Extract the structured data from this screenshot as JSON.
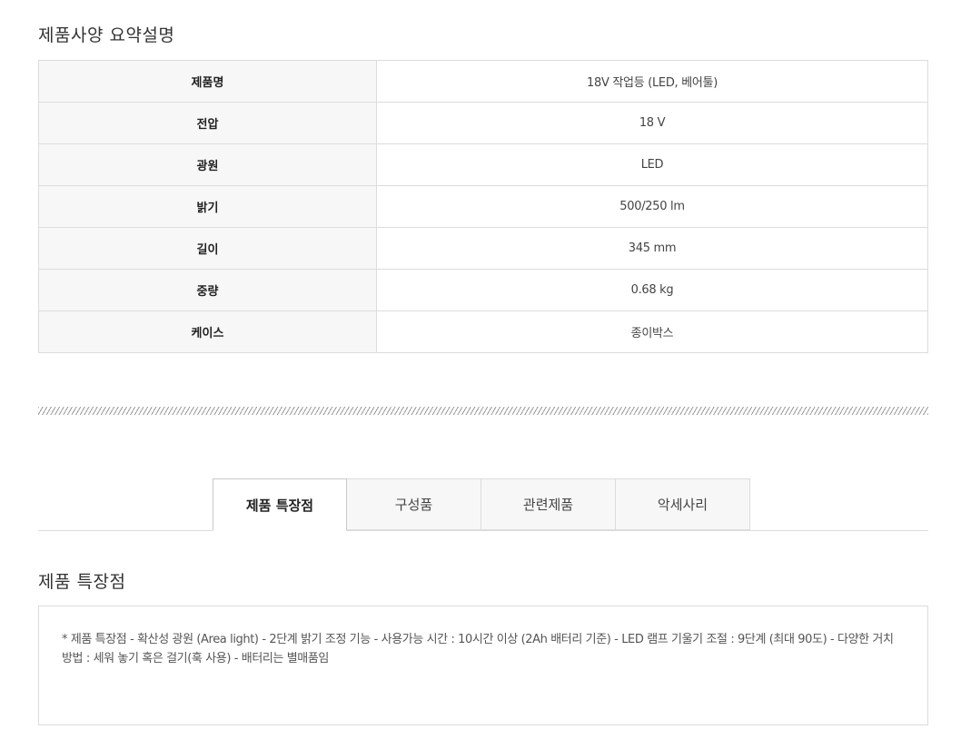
{
  "spec": {
    "title": "제품사양 요약설명",
    "rows": [
      {
        "label": "제품명",
        "value": "18V 작업등 (LED, 베어툴)"
      },
      {
        "label": "전압",
        "value": "18 V"
      },
      {
        "label": "광원",
        "value": "LED"
      },
      {
        "label": "밝기",
        "value": "500/250 lm"
      },
      {
        "label": "길이",
        "value": "345 mm"
      },
      {
        "label": "중량",
        "value": "0.68 kg"
      },
      {
        "label": "케이스",
        "value": "종이박스"
      }
    ]
  },
  "tabs": [
    {
      "label": "제품 특장점",
      "active": true
    },
    {
      "label": "구성품",
      "active": false
    },
    {
      "label": "관련제품",
      "active": false
    },
    {
      "label": "악세사리",
      "active": false
    }
  ],
  "features": {
    "title": "제품 특장점",
    "text": "* 제품 특장점 - 확산성 광원 (Area light) - 2단계 밝기 조정 기능 - 사용가능 시간 : 10시간 이상 (2Ah 배터리 기준) - LED 램프 기울기 조절 : 9단계 (최대 90도) - 다양한 거치 방법 : 세워 놓기 혹은 걸기(훅 사용) - 배터리는 별매품임"
  }
}
